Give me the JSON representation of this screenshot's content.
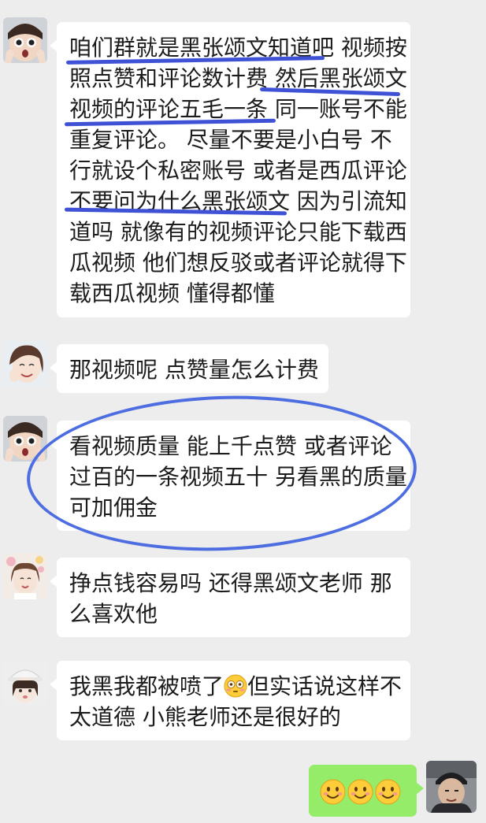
{
  "colors": {
    "background": "#ededed",
    "bubble_other": "#ffffff",
    "bubble_self": "#95ec69",
    "annotation_blue": "#3f52d6"
  },
  "messages": [
    {
      "sender": "other",
      "avatar": "avatar-girl-surprised",
      "lines": [
        "咱们群就是黑张颂文知道吧  视频按",
        "照点赞和评论数计费  然后黑张颂文",
        "视频的评论五毛一条  同一账号不能",
        "重复评论。  尽量不要是小白号  不",
        "行就设个私密账号  或者是西瓜评论",
        "不要问为什么黑张颂文  因为引流知",
        "道吗  就像有的视频评论只能下载西",
        "瓜视频  他们想反驳或者评论就得下",
        "载西瓜视频  懂得都懂"
      ]
    },
    {
      "sender": "other",
      "avatar": "avatar-girl-smiling",
      "lines": [
        "那视频呢   点赞量怎么计费"
      ]
    },
    {
      "sender": "other",
      "avatar": "avatar-girl-surprised",
      "lines": [
        "看视频质量  能上千点赞  或者评论",
        "过百的一条视频五十  另看黑的质量",
        "可加佣金"
      ]
    },
    {
      "sender": "other",
      "avatar": "avatar-girl-flowers",
      "lines": [
        "挣点钱容易吗   还得黑颂文老师  那",
        "么喜欢他"
      ]
    },
    {
      "sender": "other",
      "avatar": "avatar-girl-hat",
      "lines": [
        "我黑我都被喷了",
        "但实话说这样不",
        "太道德  小熊老师还是很好的"
      ],
      "inline_emoji": "flushed-face-emoji"
    },
    {
      "sender": "self",
      "avatar": "avatar-man-cap",
      "emojis": [
        "smile-emoji",
        "smile-emoji",
        "smile-emoji"
      ]
    }
  ]
}
